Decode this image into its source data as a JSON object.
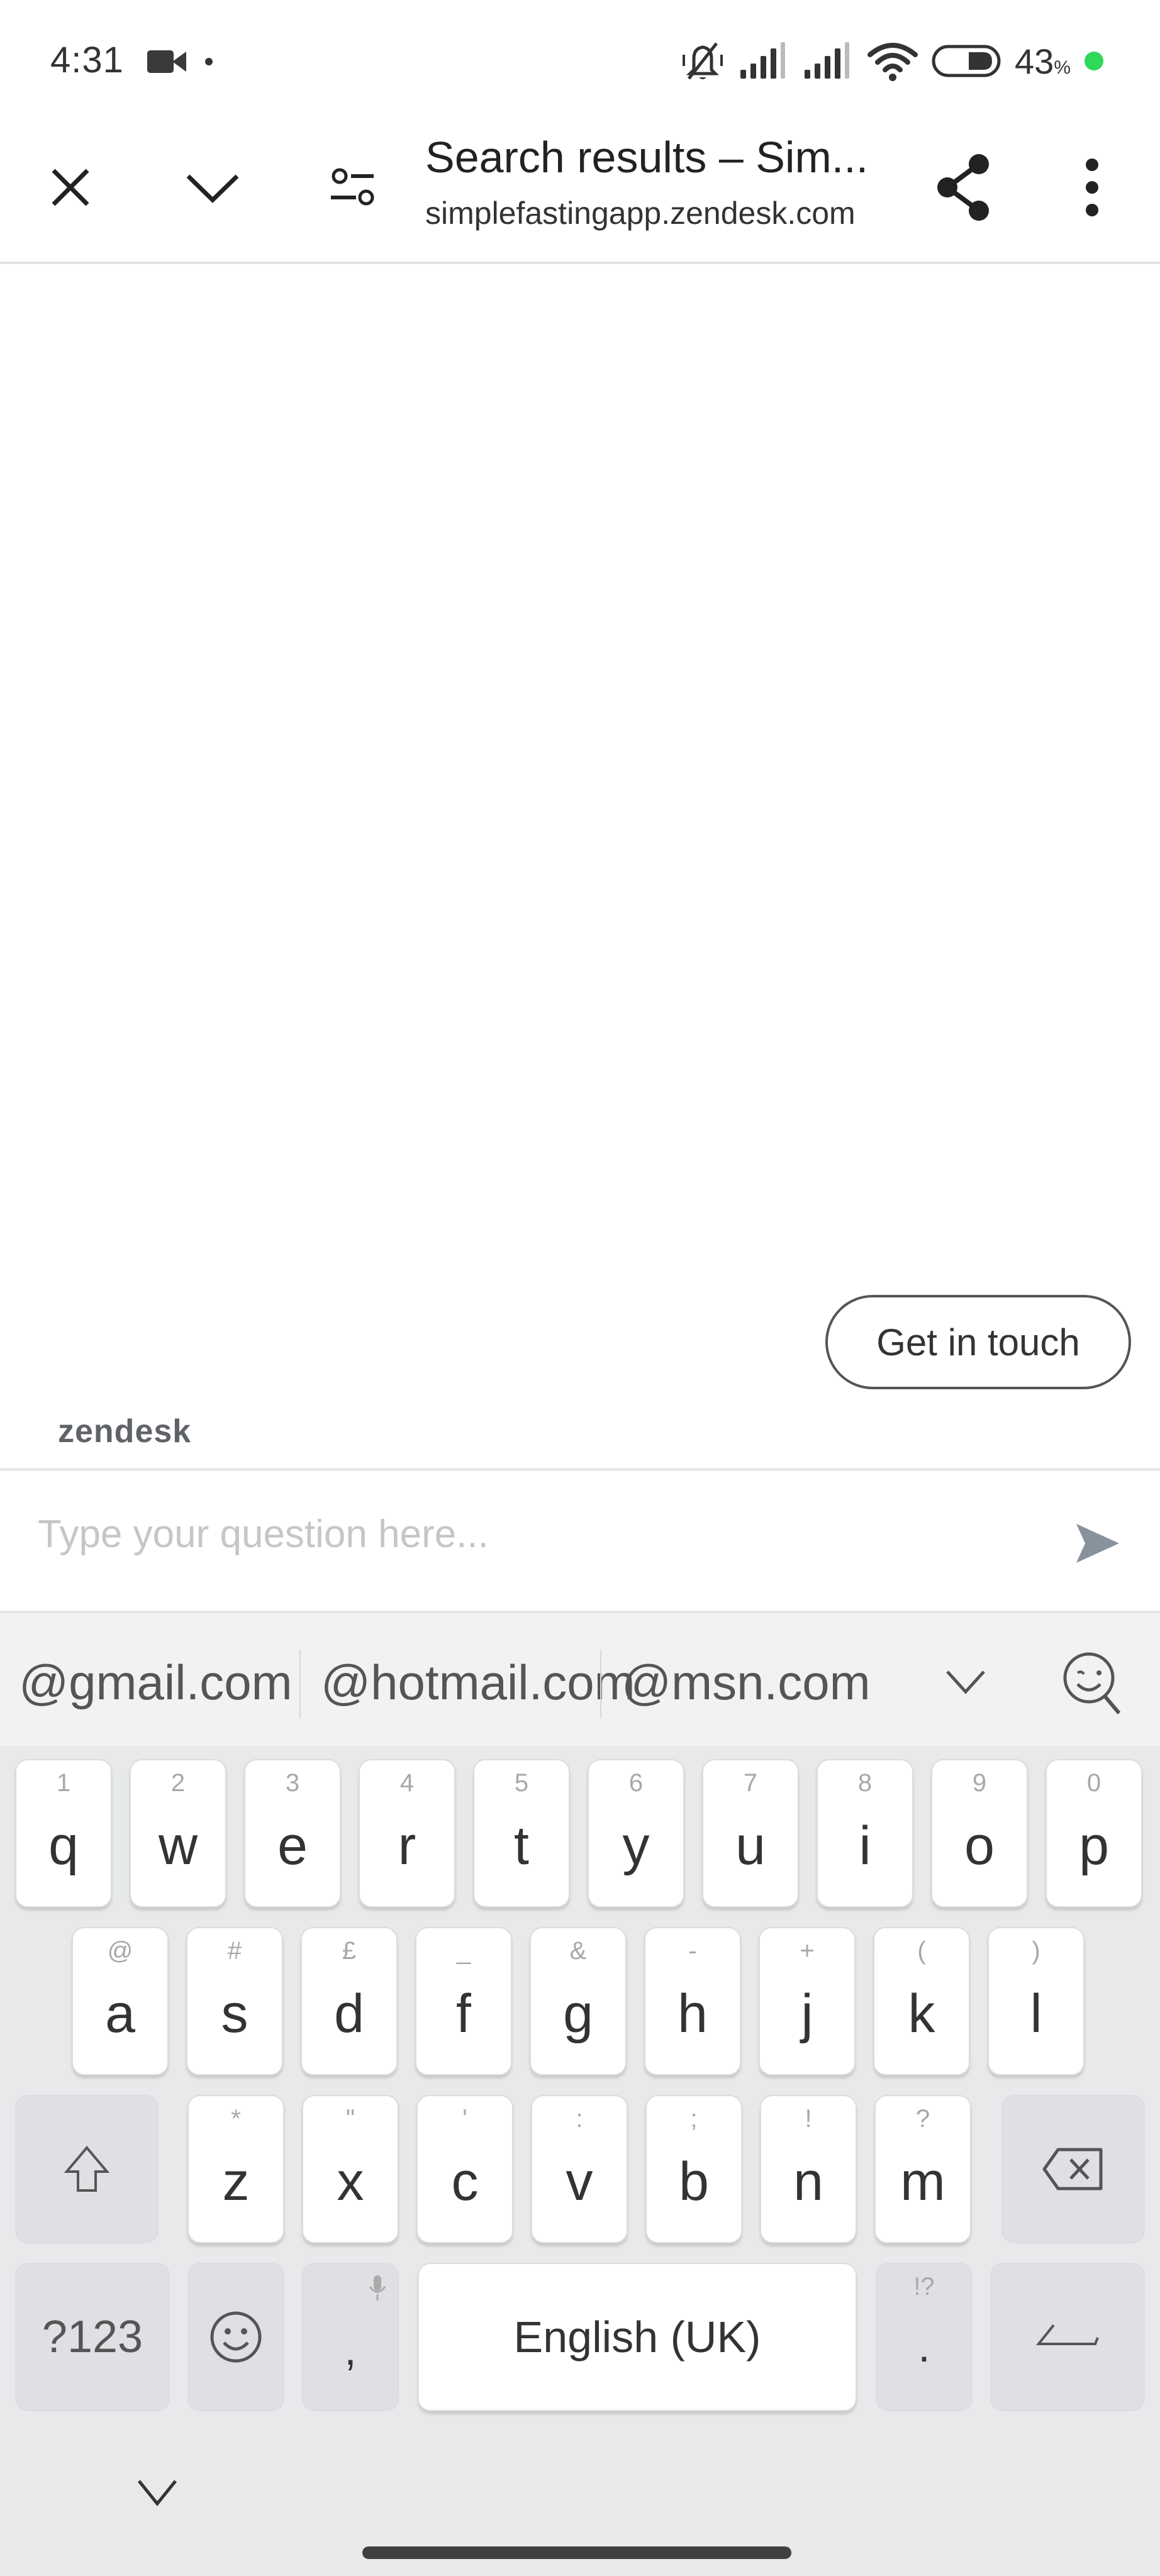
{
  "status_bar": {
    "time": "4:31",
    "left_icons": [
      "video-camera-icon",
      "notification-dot"
    ],
    "right_icons": [
      "silent-mode-icon",
      "signal-sim1-icon",
      "signal-sim2-icon",
      "wifi-icon",
      "battery-icon"
    ],
    "battery_percent": "43",
    "battery_percent_sign": "%",
    "battery_level": 0.43,
    "indicator_color": "#2fd858"
  },
  "toolbar": {
    "title": "Search results – Sim...",
    "url": "simplefastingapp.zendesk.com",
    "icons": [
      "close-icon",
      "chevron-down-icon",
      "tune-icon",
      "share-icon",
      "more-vert-icon"
    ]
  },
  "content": {
    "get_in_touch_label": "Get in touch",
    "brand": "zendesk"
  },
  "chat_input": {
    "placeholder": "Type your question here...",
    "value": "",
    "send_icon_color": "#87929d"
  },
  "keyboard": {
    "suggestions": [
      "@gmail.com",
      "@hotmail.com",
      "@msn.com"
    ],
    "rows": [
      [
        {
          "key": "q",
          "hint": "1"
        },
        {
          "key": "w",
          "hint": "2"
        },
        {
          "key": "e",
          "hint": "3"
        },
        {
          "key": "r",
          "hint": "4"
        },
        {
          "key": "t",
          "hint": "5"
        },
        {
          "key": "y",
          "hint": "6"
        },
        {
          "key": "u",
          "hint": "7"
        },
        {
          "key": "i",
          "hint": "8"
        },
        {
          "key": "o",
          "hint": "9"
        },
        {
          "key": "p",
          "hint": "0"
        }
      ],
      [
        {
          "key": "a",
          "hint": "@"
        },
        {
          "key": "s",
          "hint": "#"
        },
        {
          "key": "d",
          "hint": "£"
        },
        {
          "key": "f",
          "hint": "_"
        },
        {
          "key": "g",
          "hint": "&"
        },
        {
          "key": "h",
          "hint": "-"
        },
        {
          "key": "j",
          "hint": "+"
        },
        {
          "key": "k",
          "hint": "("
        },
        {
          "key": "l",
          "hint": ")"
        }
      ],
      [
        {
          "key": "z",
          "hint": "*"
        },
        {
          "key": "x",
          "hint": "\""
        },
        {
          "key": "c",
          "hint": "'"
        },
        {
          "key": "v",
          "hint": ":"
        },
        {
          "key": "b",
          "hint": ";"
        },
        {
          "key": "n",
          "hint": "!"
        },
        {
          "key": "m",
          "hint": "?"
        }
      ]
    ],
    "symbols_label": "?123",
    "comma": ",",
    "space_label": "English (UK)",
    "period": ".",
    "period_hint": "!?"
  }
}
